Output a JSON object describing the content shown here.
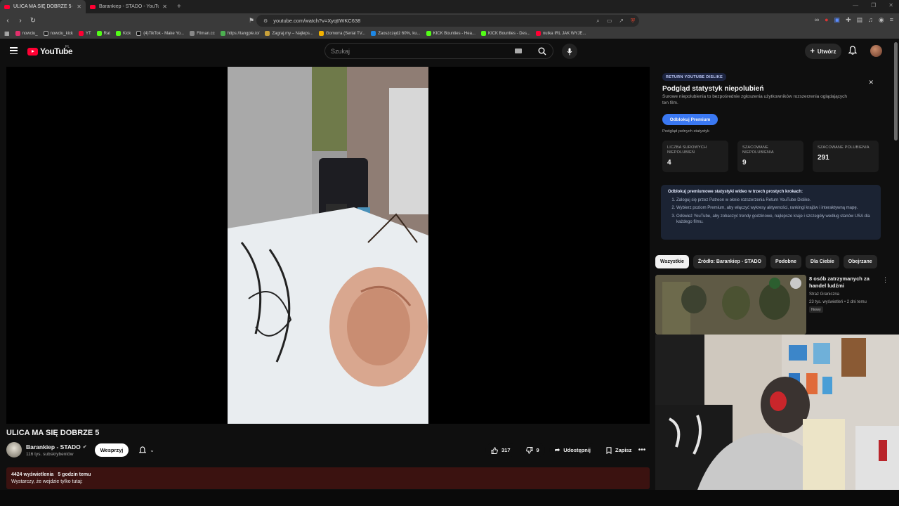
{
  "browser": {
    "tabs": [
      {
        "label": "ULICA MA SIĘ DOBRZE 5 - Yo",
        "active": true
      },
      {
        "label": "Barankiep - STADO - YouTube",
        "active": false
      }
    ],
    "new_tab": "+",
    "url": "youtube.com/watch?v=XyqtIWKC638",
    "bookmarks": [
      "nowciu_",
      "nowciu_kick",
      "YT",
      "Rat",
      "Kick",
      "(4)TikTok - Make Yo...",
      "Filman.cc",
      "https://tangple.io/",
      "Zagraj.my – Najleps...",
      "Gomorra (Serial TV...",
      "Zaoszczędź 60%, ku...",
      "KICK Bounties - Hea...",
      "KICK Bounties - Des...",
      "nutka IRL JAK WYJE..."
    ]
  },
  "header": {
    "logo_text": "YouTube",
    "country_code": "PL",
    "search_placeholder": "Szukaj",
    "create_label": "Utwórz"
  },
  "video": {
    "title": "ULICA MA SIĘ DOBRZE 5",
    "channel_name": "Barankiep - STADO",
    "subscribers": "116 tys. subskrybentów",
    "support_label": "Wesprzyj",
    "likes": "317",
    "dislikes": "9",
    "share_label": "Udostępnij",
    "save_label": "Zapisz",
    "views": "4424 wyświetlenia",
    "published": "5 godzin temu",
    "description_line": "Wystarczy, że wejdzie tylko tutaj:"
  },
  "rytd": {
    "badge": "RETURN YOUTUBE DISLIKE",
    "title": "Podgląd statystyk niepolubień",
    "subtitle": "Surowe niepolubienia to bezpośrednie zgłoszenia użytkowników rozszerzenia oglądających ten film.",
    "unlock_label": "Odblokuj Premium",
    "full_stats": "Podgląd pełnych statystyk",
    "stats": [
      {
        "label": "LICZBA SUROWYCH NIEPOLUBIEŃ",
        "value": "4"
      },
      {
        "label": "SZACOWANE NIEPOLUBIENIA",
        "value": "9"
      },
      {
        "label": "SZACOWANE POLUBIENIA",
        "value": "291"
      }
    ],
    "promo_heading": "Odblokuj premiumowe statystyki wideo w trzech prostych krokach:",
    "promo_steps": [
      "Zaloguj się przez Patreon w oknie rozszerzenia Return YouTube Dislike.",
      "Wybierz poziom Premium, aby włączyć wykresy aktywności, rankingi krajów i interaktywną mapę.",
      "Odśwież YouTube, aby zobaczyć trendy godzinowe, najlepsze kraje i szczegóły według stanów USA dla każdego filmu."
    ]
  },
  "chips": [
    "Wszystkie",
    "Źródło: Barankiep - STADO",
    "Podobne",
    "Dla Ciebie",
    "Obejrzane"
  ],
  "related": {
    "title": "8 osób zatrzymanych za handel ludźmi",
    "channel": "Straż Graniczna",
    "stats": "23 tys. wyświetleń • 2 dni temu",
    "badge": "Nowy"
  },
  "colors": {
    "accent": "#3a78f2",
    "youtube_red": "#ff0033",
    "description_bg": "#3b1210"
  }
}
